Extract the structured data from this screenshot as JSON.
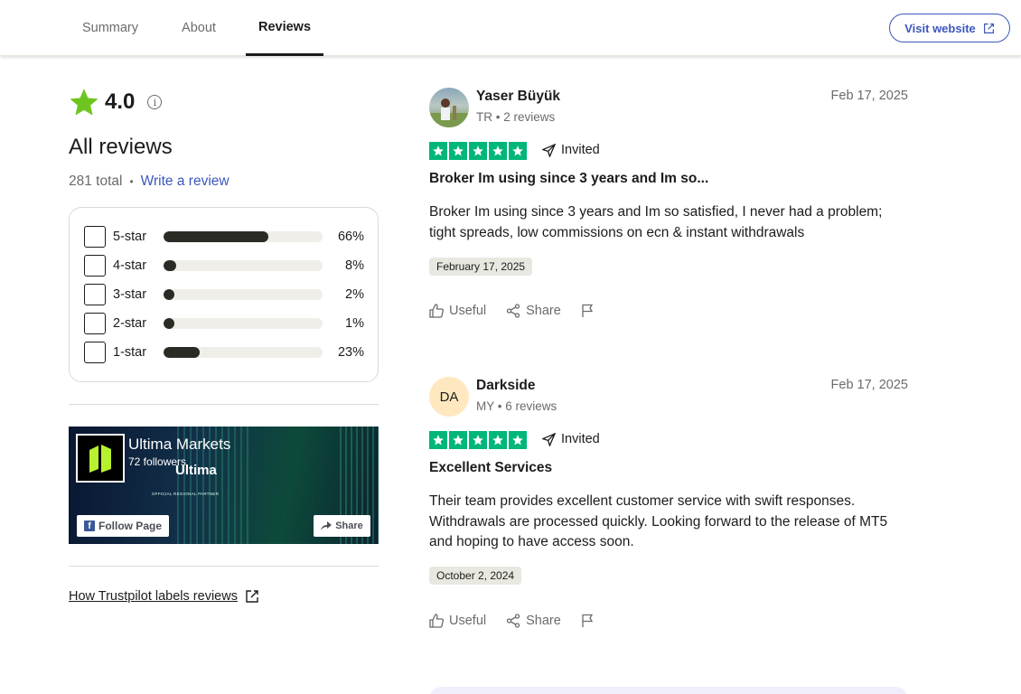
{
  "tabs": [
    {
      "label": "Summary",
      "active": false
    },
    {
      "label": "About",
      "active": false
    },
    {
      "label": "Reviews",
      "active": true
    }
  ],
  "visit_button": {
    "label": "Visit website",
    "icon": "external-link-icon"
  },
  "rating": {
    "score": "4.0",
    "info_glyph": "i"
  },
  "all_reviews": {
    "heading": "All reviews",
    "total": "281 total",
    "separator": "•",
    "write_link": "Write a review"
  },
  "distribution": [
    {
      "label": "5-star",
      "percent": "66%",
      "value": 66
    },
    {
      "label": "4-star",
      "percent": "8%",
      "value": 8
    },
    {
      "label": "3-star",
      "percent": "2%",
      "value": 2
    },
    {
      "label": "2-star",
      "percent": "1%",
      "value": 1
    },
    {
      "label": "1-star",
      "percent": "23%",
      "value": 23
    }
  ],
  "facebook": {
    "page_name": "Ultima Markets",
    "followers": "72 followers",
    "brand": "Ultima",
    "partner": "OFFICIAL REGIONAL PARTNER",
    "follow_label": "Follow Page",
    "share_label": "Share"
  },
  "labels_link": "How Trustpilot labels reviews",
  "reviews": [
    {
      "name": "Yaser Büyük",
      "meta": "TR • 2 reviews",
      "date": "Feb 17, 2025",
      "stars": 5,
      "invited": "Invited",
      "title": "Broker Im using since 3 years and Im so...",
      "body": "Broker Im using since 3 years and Im so satisfied, I never had a problem; tight spreads, low commissions on ecn & instant withdrawals",
      "experience_date": "February 17, 2025",
      "useful": "Useful",
      "share": "Share"
    },
    {
      "name": "Darkside",
      "initials": "DA",
      "meta": "MY • 6 reviews",
      "date": "Feb 17, 2025",
      "stars": 5,
      "invited": "Invited",
      "title": "Excellent Services",
      "body": "Their team provides excellent customer service with swift responses. Withdrawals are processed quickly. Looking forward to the release of MT5 and hoping to have access soon.",
      "experience_date": "October 2, 2024",
      "useful": "Useful",
      "share": "Share"
    }
  ],
  "colors": {
    "accent_blue": "#3c57bc",
    "trustpilot_green": "#00b67a",
    "rating_star": "#6fc51f",
    "bar_fill": "#2b2b26"
  }
}
